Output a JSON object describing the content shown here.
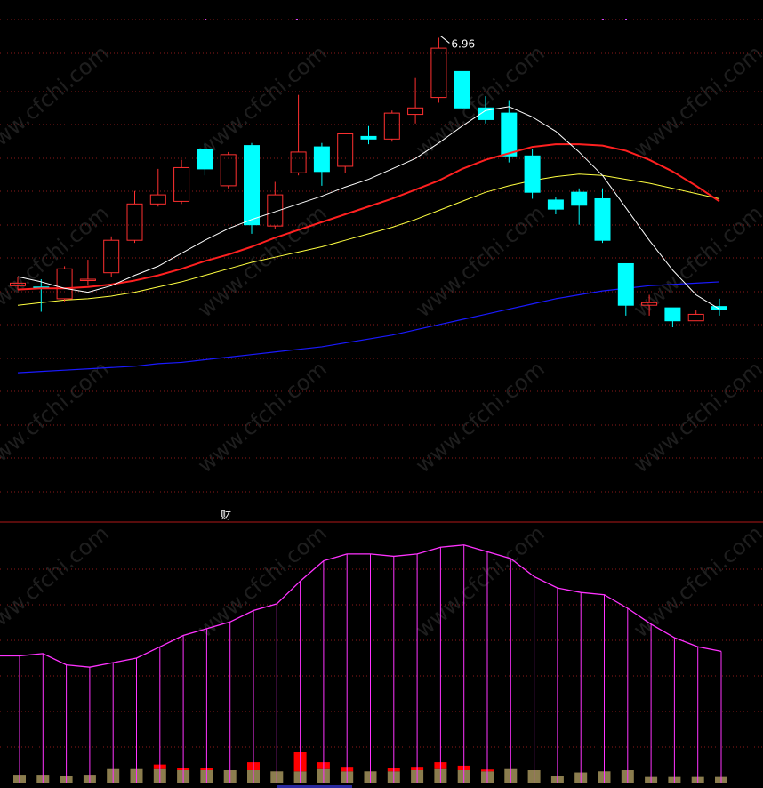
{
  "chart_data": [
    {
      "type": "candlestick",
      "peak_label": "6.96",
      "colors": {
        "up": "#ff3030",
        "down": "#00ffff",
        "ma5": "#ffffff",
        "ma10": "#ff2020",
        "ma20": "#ffff40",
        "ma60": "#1a1aff",
        "grid": "#8b1a1a"
      },
      "price_scale": {
        "top_value": 7.1,
        "bottom_value": 4.1
      },
      "candles": [
        {
          "o": 5.05,
          "c": 5.07,
          "h": 5.12,
          "l": 5.02
        },
        {
          "o": 5.04,
          "c": 5.03,
          "h": 5.1,
          "l": 4.85
        },
        {
          "o": 4.95,
          "c": 5.18,
          "h": 5.2,
          "l": 4.93
        },
        {
          "o": 5.1,
          "c": 5.1,
          "h": 5.25,
          "l": 5.05
        },
        {
          "o": 5.15,
          "c": 5.4,
          "h": 5.43,
          "l": 5.12
        },
        {
          "o": 5.4,
          "c": 5.68,
          "h": 5.78,
          "l": 5.38
        },
        {
          "o": 5.68,
          "c": 5.75,
          "h": 5.95,
          "l": 5.66
        },
        {
          "o": 5.7,
          "c": 5.96,
          "h": 6.02,
          "l": 5.68
        },
        {
          "o": 6.1,
          "c": 5.95,
          "h": 6.15,
          "l": 5.9
        },
        {
          "o": 5.82,
          "c": 6.06,
          "h": 6.08,
          "l": 5.8
        },
        {
          "o": 6.13,
          "c": 5.52,
          "h": 6.15,
          "l": 5.45
        },
        {
          "o": 5.51,
          "c": 5.75,
          "h": 5.85,
          "l": 5.49
        },
        {
          "o": 5.92,
          "c": 6.08,
          "h": 6.52,
          "l": 5.9
        },
        {
          "o": 6.12,
          "c": 5.93,
          "h": 6.15,
          "l": 5.82
        },
        {
          "o": 5.97,
          "c": 6.22,
          "h": 6.23,
          "l": 5.92
        },
        {
          "o": 6.2,
          "c": 6.18,
          "h": 6.28,
          "l": 6.14
        },
        {
          "o": 6.18,
          "c": 6.38,
          "h": 6.4,
          "l": 6.16
        },
        {
          "o": 6.37,
          "c": 6.42,
          "h": 6.65,
          "l": 6.3
        },
        {
          "o": 6.5,
          "c": 6.88,
          "h": 6.96,
          "l": 6.46
        },
        {
          "o": 6.7,
          "c": 6.42,
          "h": 6.7,
          "l": 6.41
        },
        {
          "o": 6.42,
          "c": 6.33,
          "h": 6.51,
          "l": 6.3
        },
        {
          "o": 6.38,
          "c": 6.05,
          "h": 6.48,
          "l": 6.0
        },
        {
          "o": 6.05,
          "c": 5.77,
          "h": 6.1,
          "l": 5.72
        },
        {
          "o": 5.71,
          "c": 5.64,
          "h": 5.73,
          "l": 5.6
        },
        {
          "o": 5.77,
          "c": 5.67,
          "h": 5.8,
          "l": 5.52
        },
        {
          "o": 5.72,
          "c": 5.4,
          "h": 5.8,
          "l": 5.38
        },
        {
          "o": 5.22,
          "c": 4.9,
          "h": 5.22,
          "l": 4.82
        },
        {
          "o": 4.9,
          "c": 4.92,
          "h": 4.98,
          "l": 4.82
        },
        {
          "o": 4.88,
          "c": 4.78,
          "h": 4.88,
          "l": 4.73
        },
        {
          "o": 4.78,
          "c": 4.83,
          "h": 4.86,
          "l": 4.78
        },
        {
          "o": 4.89,
          "c": 4.87,
          "h": 4.95,
          "l": 4.82
        }
      ],
      "ma5": [
        5.12,
        5.08,
        5.03,
        5.0,
        5.05,
        5.13,
        5.2,
        5.3,
        5.4,
        5.49,
        5.56,
        5.62,
        5.68,
        5.74,
        5.81,
        5.87,
        5.95,
        6.03,
        6.15,
        6.28,
        6.4,
        6.43,
        6.35,
        6.24,
        6.08,
        5.9,
        5.65,
        5.4,
        5.17,
        4.98,
        4.87
      ],
      "ma10": [
        5.02,
        5.03,
        5.03,
        5.04,
        5.06,
        5.09,
        5.13,
        5.18,
        5.24,
        5.29,
        5.35,
        5.42,
        5.48,
        5.54,
        5.6,
        5.66,
        5.72,
        5.79,
        5.86,
        5.95,
        6.02,
        6.07,
        6.12,
        6.14,
        6.14,
        6.13,
        6.09,
        6.02,
        5.93,
        5.82,
        5.7
      ],
      "ma20": [
        4.9,
        4.92,
        4.94,
        4.95,
        4.97,
        5.0,
        5.04,
        5.08,
        5.13,
        5.18,
        5.23,
        5.27,
        5.31,
        5.35,
        5.4,
        5.45,
        5.5,
        5.56,
        5.63,
        5.7,
        5.77,
        5.82,
        5.86,
        5.89,
        5.91,
        5.9,
        5.87,
        5.84,
        5.8,
        5.76,
        5.72
      ],
      "ma60": [
        4.38,
        4.39,
        4.4,
        4.41,
        4.42,
        4.43,
        4.45,
        4.46,
        4.48,
        4.5,
        4.52,
        4.54,
        4.56,
        4.58,
        4.61,
        4.64,
        4.67,
        4.71,
        4.75,
        4.79,
        4.83,
        4.87,
        4.91,
        4.95,
        4.98,
        5.01,
        5.03,
        5.05,
        5.06,
        5.07,
        5.08
      ]
    },
    {
      "type": "bar",
      "label": "财",
      "line_color": "#ff33ff",
      "line_scale": {
        "top_value": 110,
        "bottom_value": 0
      },
      "bar_scale": {
        "top_value": 110,
        "bottom_value": 0
      },
      "bar_base_color": "#8b7d4e",
      "bar_top_color": "#ff0000",
      "line_values": [
        56,
        57,
        52,
        51,
        53,
        55,
        60,
        65,
        68,
        71,
        76,
        79,
        89,
        98,
        101,
        101,
        100,
        101,
        104,
        105,
        102,
        99,
        91,
        86,
        84,
        83,
        77,
        70,
        64,
        60,
        58
      ],
      "bar_base": [
        3.5,
        3.5,
        3,
        3.5,
        6,
        6,
        6,
        5.5,
        5.5,
        5.5,
        5.5,
        5,
        5,
        6,
        5,
        5,
        5,
        5.5,
        6,
        5.5,
        5,
        6,
        5.5,
        3,
        4.5,
        5,
        5.5,
        2.5,
        2.5,
        2.5,
        2.5
      ],
      "bar_top": [
        0,
        0,
        0,
        0,
        0,
        0,
        2,
        1,
        1,
        0,
        3.5,
        0,
        8.5,
        3,
        2,
        0,
        1.5,
        1.5,
        3,
        2,
        0.8,
        0,
        0,
        0,
        0,
        0,
        0,
        0,
        0,
        0,
        0
      ]
    }
  ]
}
